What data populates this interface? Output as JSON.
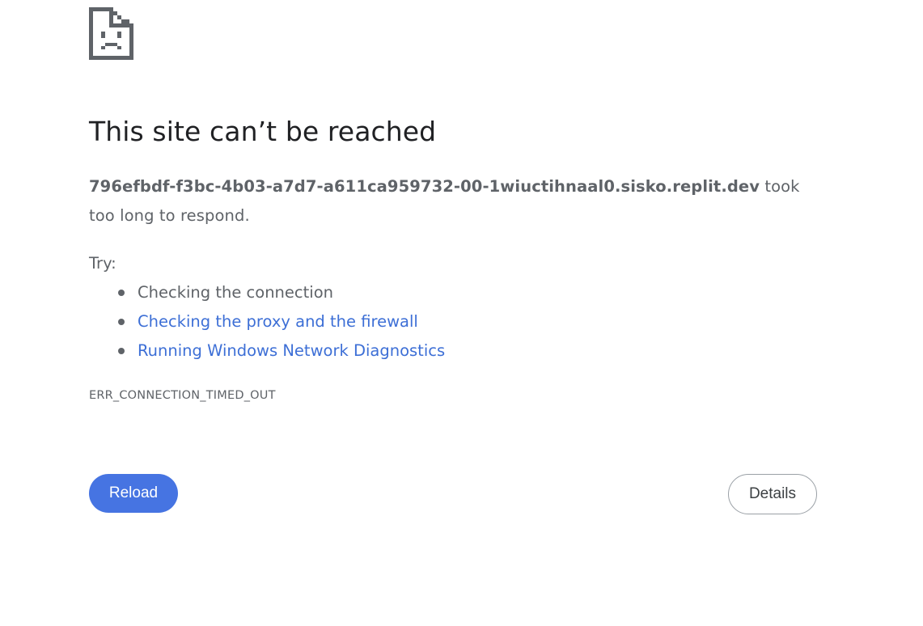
{
  "error_page": {
    "icon": "sad-page-icon",
    "title": "This site can’t be reached",
    "host": "796efbdf-f3bc-4b03-a7d7-a611ca959732-00-1wiuctihnaal0.sisko.replit.dev",
    "summary_suffix": " took too long to respond.",
    "try_label": "Try:",
    "suggestions": [
      "Checking the connection",
      "Checking the proxy and the firewall",
      "Running Windows Network Diagnostics"
    ],
    "error_code": "ERR_CONNECTION_TIMED_OUT",
    "reload_label": "Reload",
    "details_label": "Details",
    "colors": {
      "link": "#3d6fd6",
      "reload_button": "#4674e2",
      "title": "#202124",
      "body_text": "#5f6368"
    }
  }
}
